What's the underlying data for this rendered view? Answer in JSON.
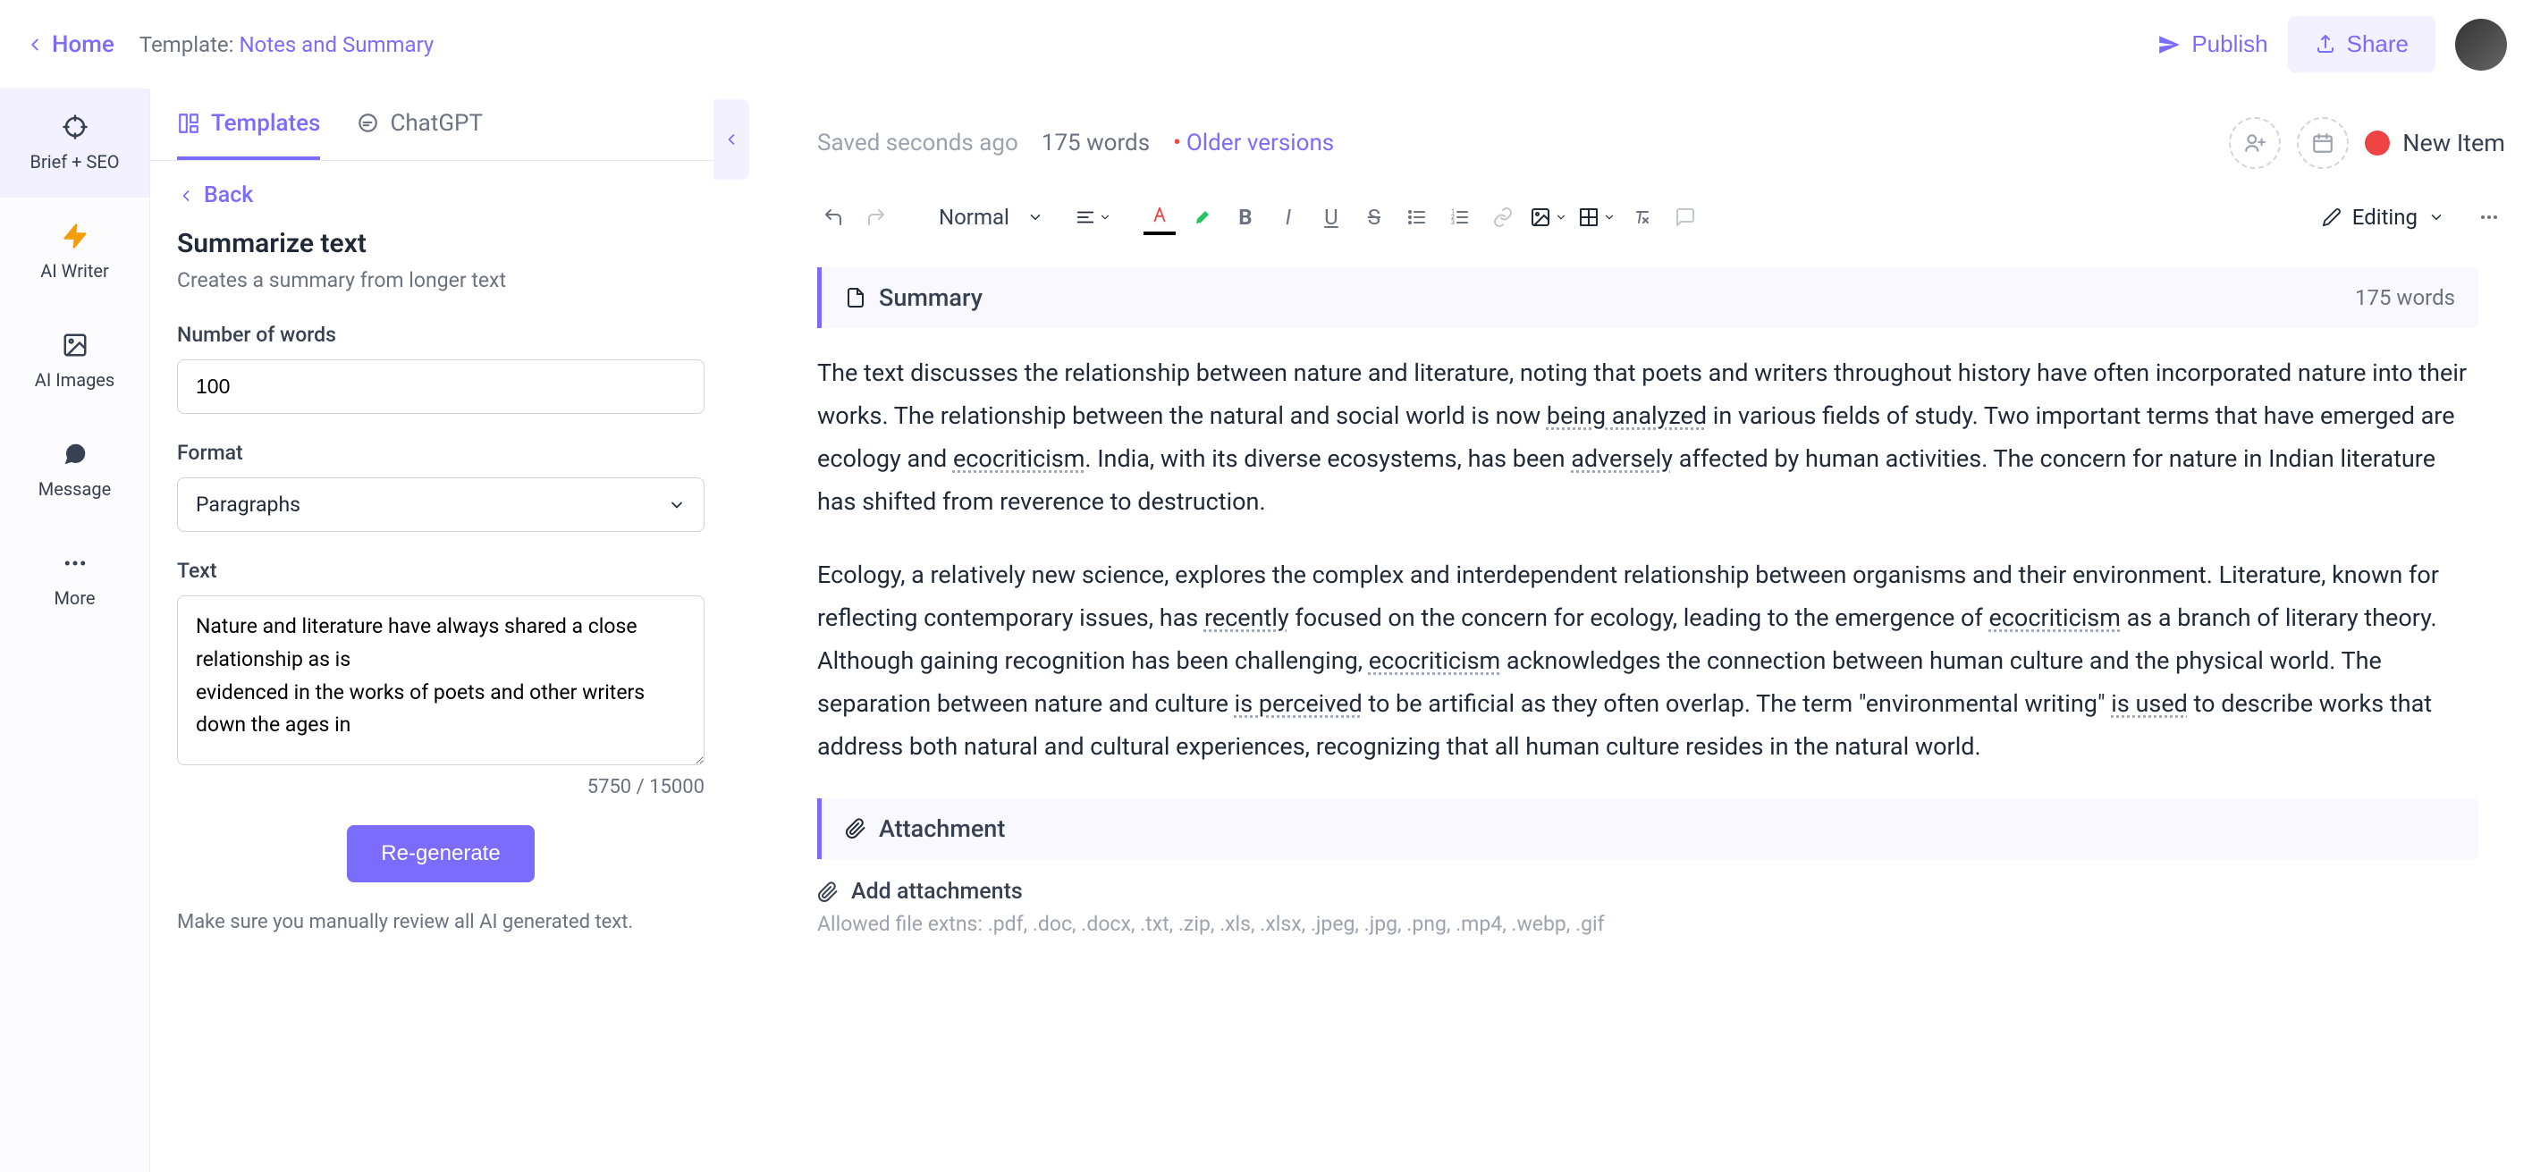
{
  "topbar": {
    "home": "Home",
    "template_prefix": "Template: ",
    "template_name": "Notes and Summary",
    "publish": "Publish",
    "share": "Share"
  },
  "leftbar": {
    "items": [
      {
        "label": "Brief + SEO"
      },
      {
        "label": "AI Writer"
      },
      {
        "label": "AI Images"
      },
      {
        "label": "Message"
      },
      {
        "label": "More"
      }
    ]
  },
  "panel": {
    "tabs": {
      "templates": "Templates",
      "chatgpt": "ChatGPT"
    },
    "back": "Back",
    "title": "Summarize text",
    "desc": "Creates a summary from longer text",
    "num_words_label": "Number of words",
    "num_words_value": "100",
    "format_label": "Format",
    "format_value": "Paragraphs",
    "text_label": "Text",
    "text_value": "Nature and literature have always shared a close relationship as is\nevidenced in the works of poets and other writers down the ages in",
    "char_count": "5750 / 15000",
    "regenerate": "Re-generate",
    "review_note": "Make sure you manually review all AI generated text."
  },
  "editor": {
    "saved": "Saved seconds ago",
    "words_top": "175 words",
    "older": "Older versions",
    "new_item": "New Item",
    "block_style": "Normal",
    "editing_mode": "Editing",
    "summary_label": "Summary",
    "summary_words": "175 words",
    "para1_a": "The text discusses the relationship between nature and literature, noting that poets and writers throughout history have often incorporated nature into their works. The relationship between the natural and social world is now ",
    "para1_b": "being analyzed",
    "para1_c": " in various fields of study. Two important terms that have emerged are ecology and ",
    "para1_d": "ecocriticism",
    "para1_e": ". India, with its diverse ecosystems, has been ",
    "para1_f": "adversely",
    "para1_g": " affected by human activities. The concern for nature in Indian literature has shifted from reverence to destruction.",
    "para2_a": "Ecology, a relatively new science, explores the complex and interdependent relationship between organisms and their environment. Literature, known for reflecting contemporary issues, has ",
    "para2_b": "recently",
    "para2_c": " focused on the concern for ecology, leading to the emergence of ",
    "para2_d": "ecocriticism",
    "para2_e": " as a branch of literary theory. Although gaining recognition has been challenging, ",
    "para2_f": "ecocriticism",
    "para2_g": " acknowledges the connection between human culture and the physical world. The separation between nature and culture ",
    "para2_h": "is perceived",
    "para2_i": " to be artificial as they often overlap. The term \"environmental writing\" ",
    "para2_j": "is used",
    "para2_k": " to describe works that address both natural and cultural experiences, recognizing that all human culture resides in the natural world.",
    "attachment_label": "Attachment",
    "add_attachments": "Add attachments",
    "allowed_ext": "Allowed file extns: .pdf, .doc, .docx, .txt, .zip, .xls, .xlsx, .jpeg, .jpg, .png, .mp4, .webp, .gif"
  }
}
